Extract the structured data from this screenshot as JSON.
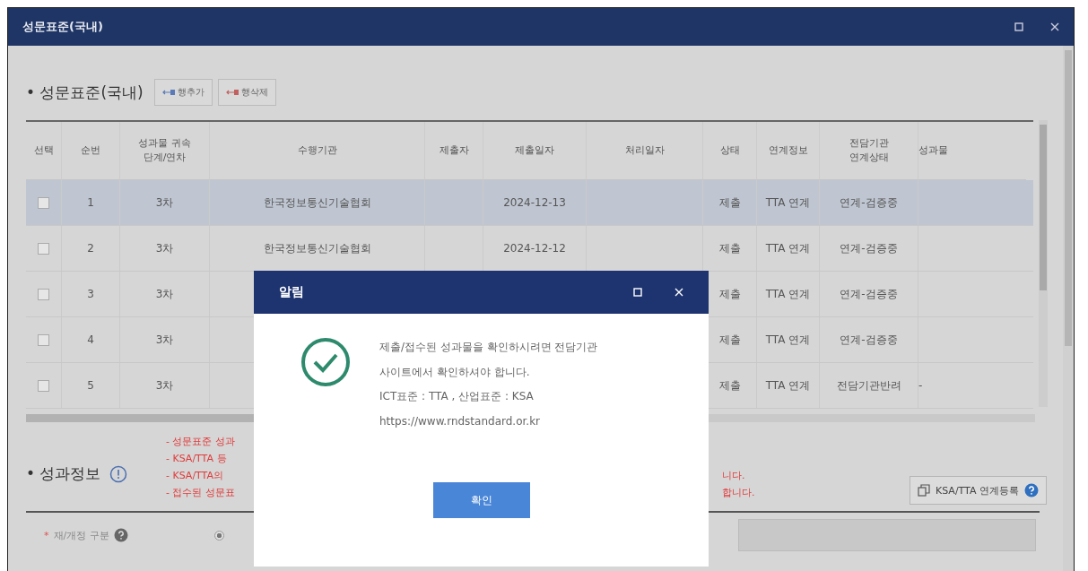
{
  "window": {
    "title": "성문표준(국내)"
  },
  "section": {
    "title": "• 성문표준(국내)",
    "buttons": [
      {
        "label": "행추가",
        "kind": "add"
      },
      {
        "label": "행삭제",
        "kind": "delete"
      }
    ]
  },
  "table": {
    "columns": [
      "선택",
      "순번",
      "성과물 귀속\n단계/연차",
      "수행기관",
      "제출자",
      "제출일자",
      "처리일자",
      "상태",
      "연계정보",
      "전담기관\n연계상태",
      "성과물"
    ],
    "rows": [
      {
        "checked": false,
        "selected": true,
        "cells": {
          "no": "1",
          "stage": "3차",
          "org": "한국정보통신기술협회",
          "date": "2024-12-13",
          "status": "제출",
          "link": "TTA 연계",
          "agency": "연계-검증중"
        }
      },
      {
        "checked": false,
        "selected": false,
        "cells": {
          "no": "2",
          "stage": "3차",
          "org": "한국정보통신기술협회",
          "date": "2024-12-12",
          "status": "제출",
          "link": "TTA 연계",
          "agency": "연계-검증중"
        }
      },
      {
        "checked": false,
        "selected": false,
        "cells": {
          "no": "3",
          "stage": "3차",
          "status": "제출",
          "link": "TTA 연계",
          "agency": "연계-검증중"
        }
      },
      {
        "checked": false,
        "selected": false,
        "cells": {
          "no": "4",
          "stage": "3차",
          "status": "제출",
          "link": "TTA 연계",
          "agency": "연계-검증중"
        }
      },
      {
        "checked": false,
        "selected": false,
        "cells": {
          "no": "5",
          "stage": "3차",
          "status": "제출",
          "link": "TTA 연계",
          "agency": "전담기관반려",
          "column_11": "-"
        }
      }
    ]
  },
  "result_section": {
    "title": "• 성과정보",
    "notes": [
      {
        "text": "- 성문표준 성과"
      },
      {
        "text": "- KSA/TTA 등"
      },
      {
        "text": "- KSA/TTA의",
        "tail": "니다."
      },
      {
        "text": "- 접수된 성문표",
        "tail": "합니다."
      }
    ],
    "link_button": "KSA/TTA 연계등록",
    "form": {
      "label": "재/개정 구분",
      "required_mark": "*",
      "radio": {
        "selected": true
      }
    }
  },
  "dialog": {
    "title": "알림",
    "lines": [
      "제출/접수된 성과물을 확인하시려면 전담기관",
      "사이트에서 확인하셔야 합니다.",
      "ICT표준 : TTA ,  산업표준 : KSA",
      "https://www.rndstandard.or.kr"
    ],
    "button": "확인"
  }
}
